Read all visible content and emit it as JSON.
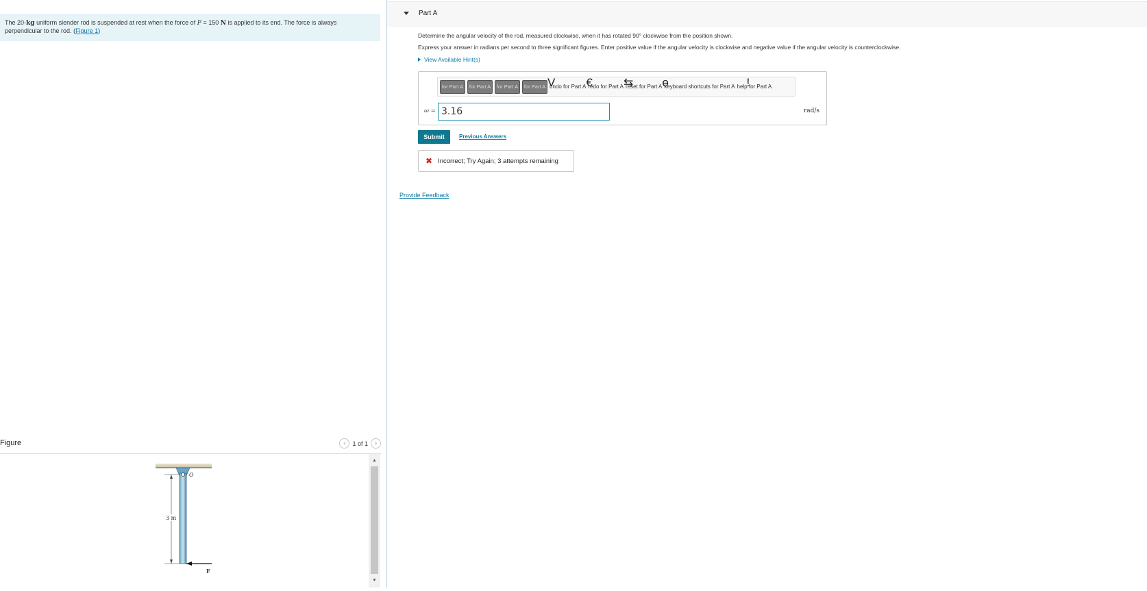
{
  "problem": {
    "text_1": "The 20-",
    "mass_unit": "kg",
    "text_2": " uniform slender rod is suspended at rest when the force of ",
    "force_var": "F",
    "text_3": " = 150 ",
    "force_unit": "N",
    "text_4": " is applied to its end. The force is always perpendicular to the rod. (",
    "figure_link": "Figure 1",
    "text_5": ")"
  },
  "figure_panel": {
    "title": "Figure",
    "pager": "1 of 1",
    "labels": {
      "pivot": "O",
      "length": "3 m",
      "force": "F"
    }
  },
  "part": {
    "title": "Part A",
    "question": "Determine the angular velocity of the rod, measured clockwise, when it has rotated 90° clockwise from the position shown.",
    "instructions": "Express your answer in radians per second to three significant figures. Enter positive value if the angular velocity is clockwise and negative value if the angular velocity is counterclockwise.",
    "hint_label": "View Available Hint(s)"
  },
  "toolbar": {
    "btn1": "for Part A",
    "btn2": "for Part A",
    "btn3": "for Part A",
    "btn4": "for Part A",
    "undo": "undo for Part A",
    "redo": "redo for Part A",
    "reset": "reset for Part A",
    "shortcuts": "keyboard shortcuts for Part A",
    "help": "help for Part A"
  },
  "answer": {
    "variable_label": "ω =",
    "value": "3.16",
    "unit": "rad/s"
  },
  "actions": {
    "submit": "Submit",
    "previous_answers": "Previous Answers",
    "result": "Incorrect; Try Again; 3 attempts remaining",
    "provide_feedback": "Provide Feedback"
  }
}
